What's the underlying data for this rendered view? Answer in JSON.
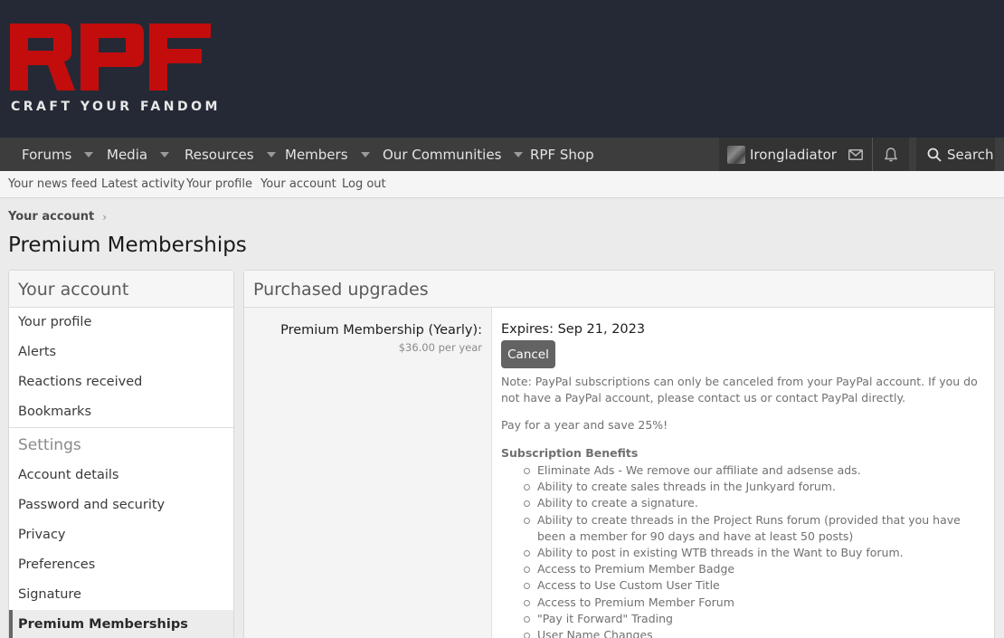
{
  "brand": {
    "logo_text": "RPF",
    "tagline": "CRAFT YOUR FANDOM",
    "logo_color": "#c30d0d"
  },
  "nav": {
    "tabs": [
      {
        "label": "Forums",
        "dropdown": true
      },
      {
        "label": "Media",
        "dropdown": true
      },
      {
        "label": "Resources",
        "dropdown": true
      },
      {
        "label": "Members",
        "dropdown": true
      },
      {
        "label": "Our Communities",
        "dropdown": true
      },
      {
        "label": "RPF Shop",
        "dropdown": false
      }
    ],
    "username": "Irongladiator",
    "search_label": "Search"
  },
  "subnav": {
    "items": [
      "Your news feed",
      "Latest activity",
      "Your profile",
      "Your account",
      "Log out"
    ]
  },
  "breadcrumb": {
    "item": "Your account"
  },
  "page": {
    "title": "Premium Memberships"
  },
  "sidebar": {
    "heading": "Your account",
    "items": [
      "Your profile",
      "Alerts",
      "Reactions received",
      "Bookmarks"
    ],
    "settings_label": "Settings",
    "settings_items": [
      "Account details",
      "Password and security",
      "Privacy",
      "Preferences",
      "Signature",
      "Premium Memberships"
    ],
    "active": "Premium Memberships"
  },
  "main": {
    "heading": "Purchased upgrades",
    "upgrade": {
      "title": "Premium Membership (Yearly):",
      "price": "$36.00 per year",
      "expires": "Expires: Sep 21, 2023",
      "cancel_label": "Cancel",
      "note": "Note: PayPal subscriptions can only be canceled from your PayPal account. If you do not have a PayPal account, please contact us or contact PayPal directly.",
      "save_text": "Pay for a year and save 25%!",
      "benefits_heading": "Subscription Benefits",
      "benefits": [
        "Eliminate Ads - We remove our affiliate and adsense ads.",
        "Ability to create sales threads in the Junkyard forum.",
        "Ability to create a signature.",
        "Ability to create threads in the Project Runs forum (provided that you have been a member for 90 days and have at least 50 posts)",
        "Ability to post in existing WTB threads in the Want to Buy forum.",
        "Access to Premium Member Badge",
        "Access to Use Custom User Title",
        "Access to Premium Member Forum",
        "\"Pay it Forward\" Trading",
        "User Name Changes"
      ]
    }
  }
}
